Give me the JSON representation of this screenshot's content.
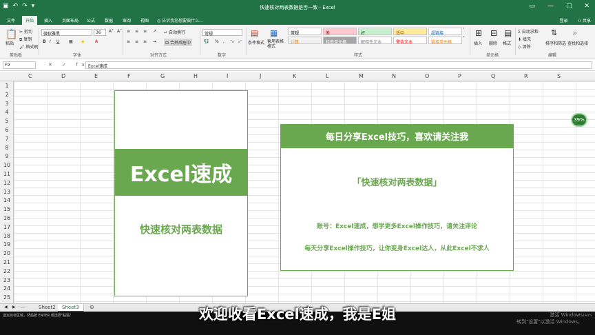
{
  "window": {
    "title": "快速核对两表数据是否一致 - Excel",
    "controls": [
      "▭",
      "—",
      "□",
      "✕"
    ]
  },
  "ribbon_tabs": [
    {
      "label": "文件"
    },
    {
      "label": "开始"
    },
    {
      "label": "插入"
    },
    {
      "label": "页面布局"
    },
    {
      "label": "公式"
    },
    {
      "label": "数据"
    },
    {
      "label": "审阅"
    },
    {
      "label": "视图"
    }
  ],
  "tell_me": "告诉我您想要做什么...",
  "account": {
    "login": "登录",
    "share": "共享"
  },
  "ribbon": {
    "clipboard": {
      "paste": "粘贴",
      "cut": "剪切",
      "copy": "复制",
      "format_painter": "格式刷",
      "label": "剪贴板"
    },
    "font": {
      "name": "微软雅黑",
      "size": "36",
      "label": "字体"
    },
    "alignment": {
      "wrap": "自动换行",
      "merge": "合并后居中",
      "label": "对齐方式"
    },
    "number": {
      "format": "常规",
      "label": "数字"
    },
    "styles": {
      "conditional": "条件格式",
      "table": "套用表格格式",
      "cells": [
        {
          "label": "常规",
          "bg": "#ffffff",
          "fg": "#000000"
        },
        {
          "label": "差",
          "bg": "#ffc7ce",
          "fg": "#9c0006"
        },
        {
          "label": "好",
          "bg": "#c6efce",
          "fg": "#006100"
        },
        {
          "label": "适中",
          "bg": "#ffeb9c",
          "fg": "#9c5700"
        },
        {
          "label": "超链接",
          "bg": "#ffffff",
          "fg": "#0563c1"
        },
        {
          "label": "计算",
          "bg": "#f2f2f2",
          "fg": "#fa7d00"
        },
        {
          "label": "检查单元格",
          "bg": "#a5a5a5",
          "fg": "#ffffff"
        },
        {
          "label": "解释性文本",
          "bg": "#ffffff",
          "fg": "#7f7f7f"
        },
        {
          "label": "警告文本",
          "bg": "#ffffff",
          "fg": "#ff0000"
        },
        {
          "label": "链接单元格",
          "bg": "#ffffff",
          "fg": "#fa7d00"
        }
      ],
      "label": "样式"
    },
    "cells_group": {
      "insert": "插入",
      "delete": "删除",
      "format": "格式",
      "label": "单元格"
    },
    "editing": {
      "autosum": "自动求和",
      "fill": "填充",
      "clear": "清除",
      "sort": "排序和筛选",
      "find": "查找和选择",
      "label": "编辑"
    }
  },
  "formula_bar": {
    "name_box": "F9",
    "fx": "✕ ✓ fx",
    "content": "Excel速成"
  },
  "columns": [
    "C",
    "D",
    "E",
    "F",
    "G",
    "H",
    "I",
    "J",
    "K",
    "L",
    "M",
    "N",
    "O",
    "P",
    "Q",
    "R",
    "S"
  ],
  "rows": [
    "1",
    "2",
    "3",
    "4",
    "5",
    "6",
    "7",
    "8",
    "9",
    "10",
    "11",
    "12",
    "13",
    "14",
    "15",
    "16",
    "17",
    "18",
    "19",
    "20",
    "21",
    "22",
    "23",
    "24",
    "25"
  ],
  "left_panel": {
    "banner": "Excel速成",
    "subtitle": "快速核对两表数据"
  },
  "right_panel": {
    "header": "每日分享Excel技巧，喜欢请关注我",
    "title": "「快速核对两表数据」",
    "line1": "账号：Excel速成，想学更多Excel操作技巧，请关注评论",
    "line2": "每天分享Excel操作技巧，让你变身Excel达人，从此Excel不求人"
  },
  "zoom_badge": "39%",
  "sheets": [
    {
      "label": "Sheet2",
      "active": false
    },
    {
      "label": "Sheet3",
      "active": true
    }
  ],
  "add_sheet": "⊕",
  "status": {
    "text": "选定目标区域，然后按 ENTER 或选择\"粘贴\"",
    "activate1": "激活 Windows",
    "activate2": "转到\"设置\"以激活 Windows。",
    "zoom": "140%"
  },
  "subtitle": "欢迎收看Excel速成，我是E姐",
  "colors": {
    "excel_green": "#217346",
    "accent_green": "#6aa84f"
  }
}
